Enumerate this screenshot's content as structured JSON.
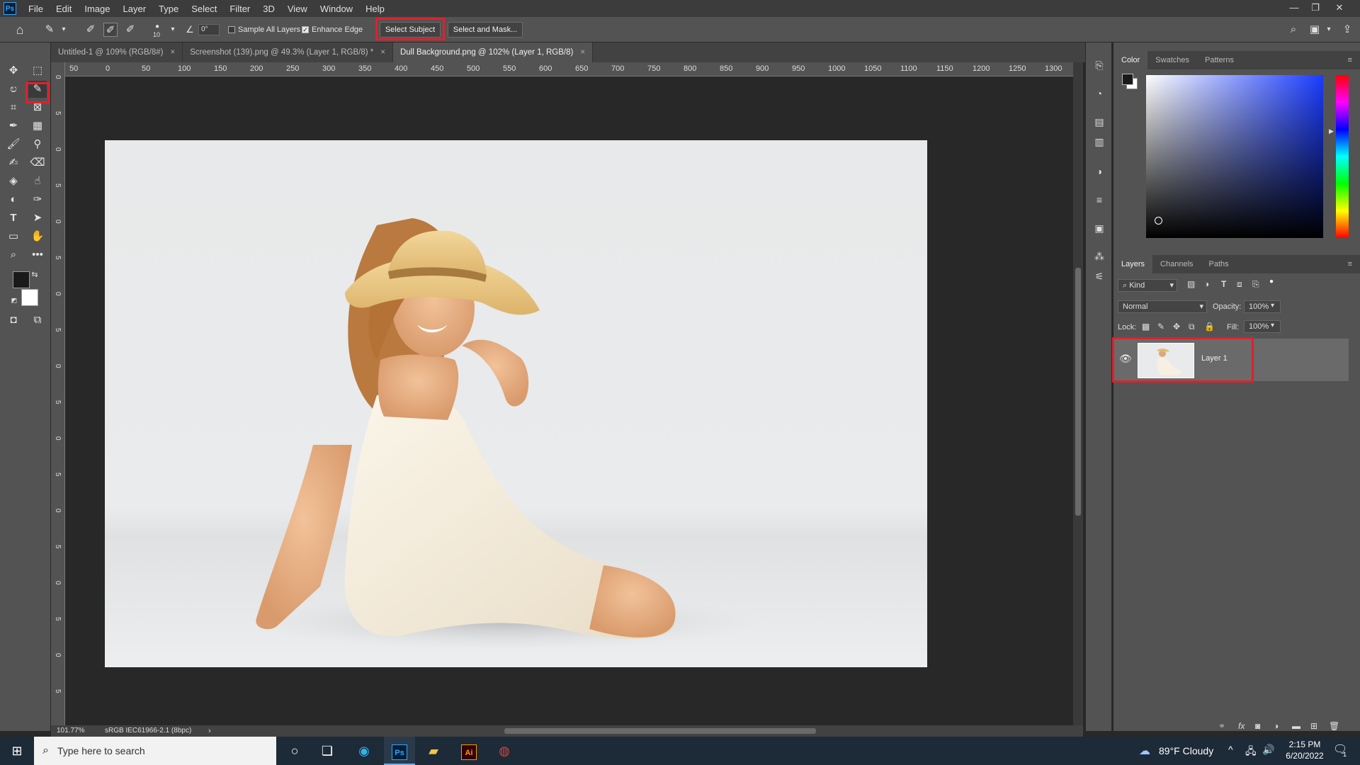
{
  "menu": {
    "items": [
      "File",
      "Edit",
      "Image",
      "Layer",
      "Type",
      "Select",
      "Filter",
      "3D",
      "View",
      "Window",
      "Help"
    ]
  },
  "options_bar": {
    "brush_size": "10",
    "angle": "0°",
    "sample_all_layers_label": "Sample All Layers",
    "sample_all_layers_checked": false,
    "enhance_edge_label": "Enhance Edge",
    "enhance_edge_checked": true,
    "select_subject_label": "Select Subject",
    "select_and_mask_label": "Select and Mask..."
  },
  "tabs": [
    {
      "label": "Untitled-1 @ 109% (RGB/8#)",
      "active": false
    },
    {
      "label": "Screenshot (139).png @ 49.3% (Layer 1, RGB/8) *",
      "active": false
    },
    {
      "label": "Dull Background.png @ 102% (Layer 1, RGB/8)",
      "active": true
    }
  ],
  "ruler": {
    "h_labels": [
      "50",
      "0",
      "50",
      "100",
      "150",
      "200",
      "250",
      "300",
      "350",
      "400",
      "450",
      "500",
      "550",
      "600",
      "650",
      "700",
      "750",
      "800",
      "850",
      "900",
      "950",
      "1000",
      "1050",
      "1100",
      "1150",
      "1200",
      "1250",
      "1300"
    ],
    "v_labels": [
      "0",
      "5",
      "0",
      "5",
      "0",
      "5",
      "0",
      "5",
      "0",
      "5",
      "0",
      "5",
      "0",
      "5",
      "0",
      "5",
      "0",
      "5",
      "0",
      "5"
    ]
  },
  "status_bar": {
    "zoom": "101.77%",
    "profile": "sRGB IEC61966-2.1 (8bpc)"
  },
  "color_panel": {
    "tabs": [
      "Color",
      "Swatches",
      "Patterns"
    ],
    "base_hue": "#1a3cff",
    "foreground": "#1a1a1a",
    "background": "#ffffff"
  },
  "layers_panel": {
    "tabs": [
      "Layers",
      "Channels",
      "Paths"
    ],
    "filter_kind": "Kind",
    "blend_mode": "Normal",
    "opacity_label": "Opacity:",
    "opacity": "100%",
    "lock_label": "Lock:",
    "fill_label": "Fill:",
    "fill": "100%",
    "layers": [
      {
        "name": "Layer 1",
        "visible": true
      }
    ]
  },
  "taskbar": {
    "search_placeholder": "Type here to search",
    "weather": "89°F  Cloudy",
    "time": "2:15 PM",
    "date": "6/20/2022",
    "notification_count": "1"
  },
  "colors": {
    "highlight": "#e0202c",
    "accent": "#31a8ff"
  }
}
